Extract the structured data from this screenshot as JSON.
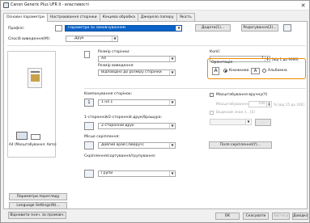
{
  "window": {
    "title": "Canon Generic Plus UFR II - властивості",
    "close_glyph": "✕"
  },
  "tabs": [
    {
      "label": "Основні параметри",
      "active": true
    },
    {
      "label": "Настроювання сторінки",
      "active": false
    },
    {
      "label": "Кінцева обробка",
      "active": false
    },
    {
      "label": "Джерело паперу",
      "active": false
    },
    {
      "label": "Якість",
      "active": false
    }
  ],
  "profile": {
    "label": "Профілі:",
    "value": "Параметри за замовчуванням",
    "add_button": "Додати(1)...",
    "edit_button": "Редагування(2)..."
  },
  "output_method": {
    "label": "Спосіб виведення(M):",
    "value": "Друк"
  },
  "preview": {
    "caption": "A4 (Масштабування: Авто)"
  },
  "page_size": {
    "label": "Розмір сторінки:",
    "value": "A4"
  },
  "output_size": {
    "label": "Розмір виведення:",
    "value": "Відповідно до розміру сторінки"
  },
  "copies": {
    "label": "Копії:",
    "value": "1",
    "range": "[від 1 до 9999]"
  },
  "orientation": {
    "label": "Орієнтація",
    "portrait_label": "Книжкова",
    "landscape_label": "Альбомна",
    "selected": "portrait"
  },
  "page_layout": {
    "label": "Компонування сторінок:",
    "value": "1 на 1"
  },
  "manual_scaling": {
    "label": "Масштабування вручну(Y)",
    "sub_label": "Масштабування:",
    "value": "100",
    "unit_range": "% [від 25 до 200]",
    "watermark_label": "Водяний знак з...(E)"
  },
  "duplex": {
    "label": "1-сторонній/2-сторонній друк/брошура:",
    "value": "2-сторонній друк"
  },
  "binding": {
    "label": "Місце скріплення:",
    "value": "Довгий край [ліворуч]",
    "margin_button": "Поля скріплення(Y)..."
  },
  "collate": {
    "label": "Скріплення/сортування/групування:",
    "value": "Групи"
  },
  "left_buttons": {
    "view_settings": "Параметри перегляду",
    "language_settings": "Language Settings(N)...",
    "restore_defaults": "Відновити знач. за промовч."
  },
  "footer": {
    "ok": "OK",
    "cancel": "Скасувати",
    "apply": "Застосу",
    "help": "Довідка"
  },
  "colors": {
    "selection": "#0a63c9",
    "highlight_frame": "#f08a00"
  }
}
